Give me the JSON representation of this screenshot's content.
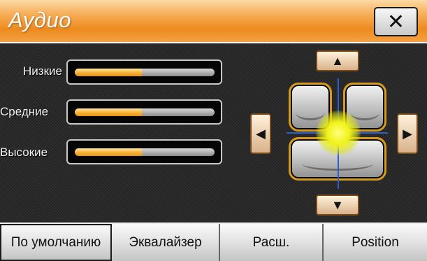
{
  "window": {
    "title": "Аудио"
  },
  "close_button": {
    "glyph": "✕"
  },
  "bands": [
    {
      "label": "Низкие",
      "level_percent": 48
    },
    {
      "label": "Средние",
      "level_percent": 48
    },
    {
      "label": "Высокие",
      "level_percent": 48
    }
  ],
  "balance": {
    "up_glyph": "▲",
    "down_glyph": "▼",
    "left_glyph": "◀",
    "right_glyph": "▶",
    "focus_color": "#f2f21a"
  },
  "tabs": [
    {
      "label": "По умолчанию"
    },
    {
      "label": "Эквалайзер"
    },
    {
      "label": "Расш."
    },
    {
      "label": "Position"
    }
  ],
  "colors": {
    "title_bar": "#ee8a1e",
    "slider_fill": "#f6b132",
    "crosshair": "#2e5fcf",
    "seat_outline": "#d69a1e"
  }
}
